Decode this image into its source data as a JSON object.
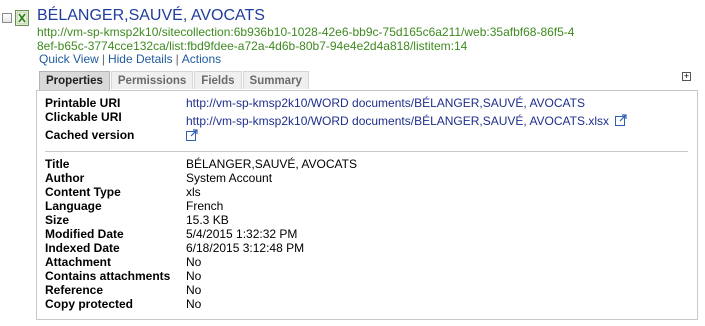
{
  "result": {
    "title": "BÉLANGER,SAUVÉ, AVOCATS",
    "url": "http://vm-sp-kmsp2k10/sitecollection:6b936b10-1028-42e6-bb9c-75d165c6a211/web:35afbf68-86f5-48ef-b65c-3774cce132ca/list:fbd9fdee-a72a-4d6b-80b7-94e4e2d4a818/listitem:14",
    "actions": {
      "quick_view": "Quick View",
      "sep": "|",
      "hide_details": "Hide Details",
      "actions": "Actions"
    }
  },
  "tabs": [
    "Properties",
    "Permissions",
    "Fields",
    "Summary"
  ],
  "expand_symbol": "+",
  "properties": {
    "printable_uri_label": "Printable URI",
    "printable_uri_value": "http://vm-sp-kmsp2k10/WORD documents/BÉLANGER,SAUVÉ, AVOCATS",
    "clickable_uri_label": "Clickable URI",
    "clickable_uri_value": "http://vm-sp-kmsp2k10/WORD documents/BÉLANGER,SAUVÉ, AVOCATS.xlsx",
    "cached_version_label": "Cached version",
    "fields": [
      {
        "label": "Title",
        "value": "BÉLANGER,SAUVÉ, AVOCATS"
      },
      {
        "label": "Author",
        "value": "System Account"
      },
      {
        "label": "Content Type",
        "value": "xls"
      },
      {
        "label": "Language",
        "value": "French"
      },
      {
        "label": "Size",
        "value": "15.3 KB"
      },
      {
        "label": "Modified Date",
        "value": "5/4/2015 1:32:32 PM"
      },
      {
        "label": "Indexed Date",
        "value": "6/18/2015 3:12:48 PM"
      },
      {
        "label": "Attachment",
        "value": "No"
      },
      {
        "label": "Contains attachments",
        "value": "No"
      },
      {
        "label": "Reference",
        "value": "No"
      },
      {
        "label": "Copy protected",
        "value": "No"
      }
    ]
  },
  "icons": {
    "file_type": "excel-file-icon",
    "external_link": "external-link-icon"
  },
  "colors": {
    "title_link": "#1f3d9c",
    "url_green": "#3d8a1f",
    "link_blue": "#1f2f8c"
  }
}
